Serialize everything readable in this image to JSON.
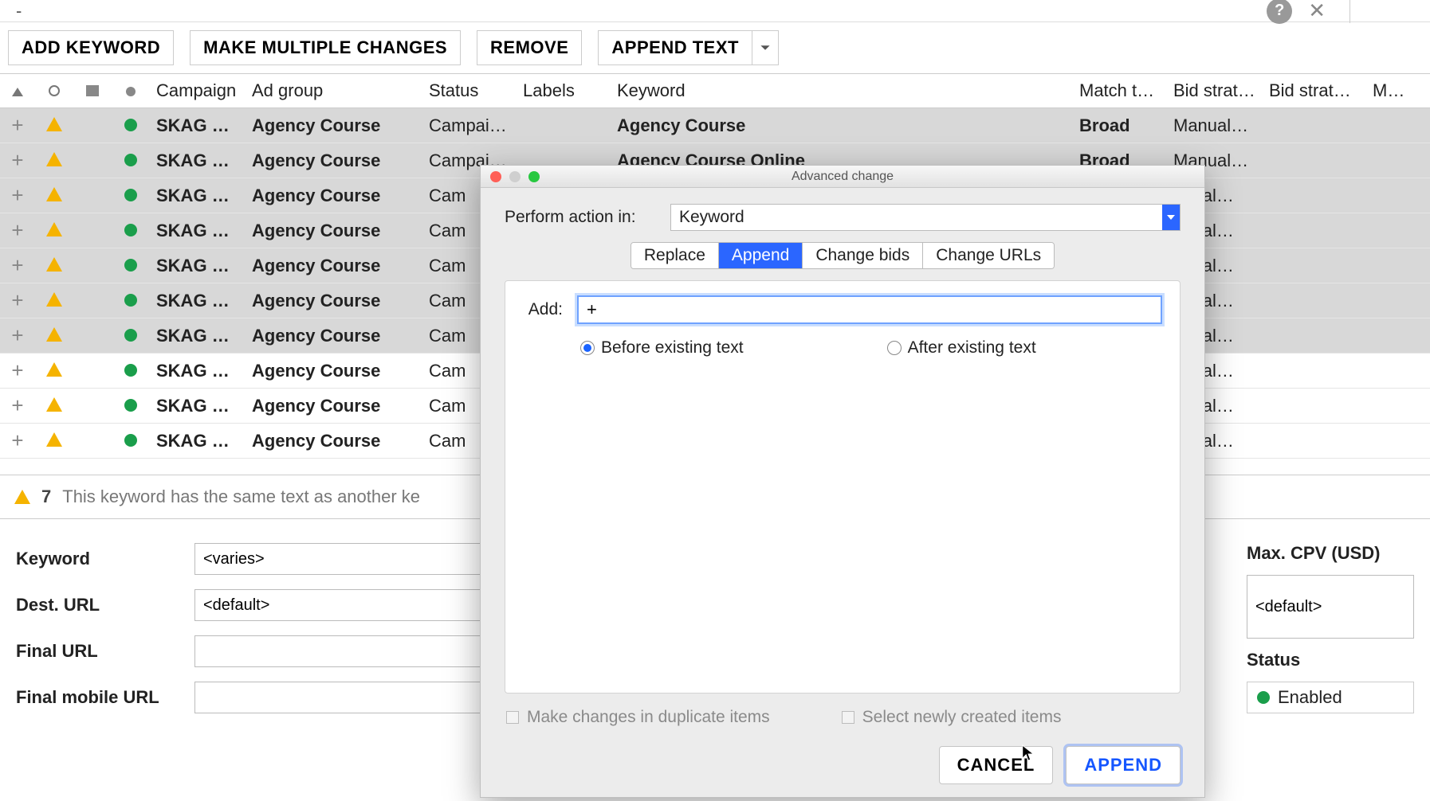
{
  "topbar": {
    "search_value": "-"
  },
  "toolbar": {
    "add_keyword": "ADD KEYWORD",
    "make_multiple": "MAKE MULTIPLE CHANGES",
    "remove": "REMOVE",
    "append_text": "APPEND TEXT"
  },
  "columns": {
    "campaign": "Campaign",
    "ad_group": "Ad group",
    "status": "Status",
    "labels": "Labels",
    "keyword": "Keyword",
    "match_type": "Match t…",
    "bid_strat1": "Bid strat…",
    "bid_strat2": "Bid strat…",
    "max": "Max."
  },
  "rows": [
    {
      "selected": true,
      "campaign": "SKAG S…",
      "ad_group": "Agency Course",
      "status": "Campai…",
      "keyword": "Agency Course",
      "match": "Broad",
      "bid": "Manual…"
    },
    {
      "selected": true,
      "campaign": "SKAG S…",
      "ad_group": "Agency Course",
      "status": "Campai…",
      "keyword": "Agency Course Online",
      "match": "Broad",
      "bid": "Manual…"
    },
    {
      "selected": true,
      "campaign": "SKAG S…",
      "ad_group": "Agency Course",
      "status": "Cam",
      "keyword": "",
      "match": "",
      "bid": "anual…"
    },
    {
      "selected": true,
      "campaign": "SKAG S…",
      "ad_group": "Agency Course",
      "status": "Cam",
      "keyword": "",
      "match": "",
      "bid": "anual…"
    },
    {
      "selected": true,
      "campaign": "SKAG S…",
      "ad_group": "Agency Course",
      "status": "Cam",
      "keyword": "",
      "match": "",
      "bid": "anual…"
    },
    {
      "selected": true,
      "campaign": "SKAG S…",
      "ad_group": "Agency Course",
      "status": "Cam",
      "keyword": "",
      "match": "",
      "bid": "anual…"
    },
    {
      "selected": true,
      "campaign": "SKAG S…",
      "ad_group": "Agency Course",
      "status": "Cam",
      "keyword": "",
      "match": "",
      "bid": "anual…"
    },
    {
      "selected": false,
      "campaign": "SKAG S…",
      "ad_group": "Agency Course",
      "status": "Cam",
      "keyword": "",
      "match": "",
      "bid": "anual…"
    },
    {
      "selected": false,
      "campaign": "SKAG S…",
      "ad_group": "Agency Course",
      "status": "Cam",
      "keyword": "",
      "match": "",
      "bid": "anual…"
    },
    {
      "selected": false,
      "campaign": "SKAG S…",
      "ad_group": "Agency Course",
      "status": "Cam",
      "keyword": "",
      "match": "",
      "bid": "anual…"
    }
  ],
  "notice": {
    "count": "7",
    "text": "This keyword has the same text as another ke"
  },
  "detail": {
    "keyword_label": "Keyword",
    "keyword_value": "<varies>",
    "dest_label": "Dest. URL",
    "dest_value": "<default>",
    "final_label": "Final URL",
    "final_value": "",
    "finalm_label": "Final mobile URL",
    "finalm_value": "",
    "maxcpv_label": "Max. CPV (USD)",
    "maxcpv_value": "<default>",
    "status_label": "Status",
    "status_value": "Enabled"
  },
  "modal": {
    "title": "Advanced change",
    "perform_label": "Perform action in:",
    "perform_value": "Keyword",
    "tabs": {
      "replace": "Replace",
      "append": "Append",
      "change_bids": "Change bids",
      "change_urls": "Change URLs"
    },
    "add_label": "Add:",
    "add_value": "+",
    "radio_before": "Before existing text",
    "radio_after": "After existing text",
    "chk_dup": "Make changes in duplicate items",
    "chk_select_new": "Select newly created items",
    "cancel": "CANCEL",
    "append": "APPEND"
  }
}
